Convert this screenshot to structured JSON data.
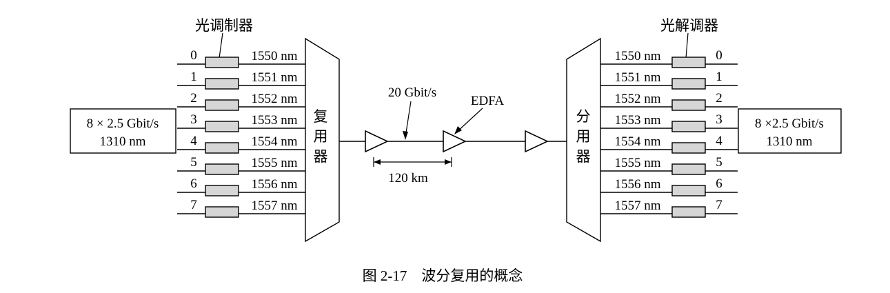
{
  "left": {
    "modulator_label": "光调制器",
    "mux_label": [
      "复",
      "用",
      "器"
    ],
    "source_box": [
      "8 × 2.5 Gbit/s",
      "1310 nm"
    ]
  },
  "right": {
    "demodulator_label": "光解调器",
    "demux_label": [
      "分",
      "用",
      "器"
    ],
    "sink_box": [
      "8 ×2.5 Gbit/s",
      "1310 nm"
    ]
  },
  "channels": [
    {
      "index": "0",
      "wavelength": "1550 nm"
    },
    {
      "index": "1",
      "wavelength": "1551 nm"
    },
    {
      "index": "2",
      "wavelength": "1552 nm"
    },
    {
      "index": "3",
      "wavelength": "1553 nm"
    },
    {
      "index": "4",
      "wavelength": "1554 nm"
    },
    {
      "index": "5",
      "wavelength": "1555 nm"
    },
    {
      "index": "6",
      "wavelength": "1556 nm"
    },
    {
      "index": "7",
      "wavelength": "1557 nm"
    }
  ],
  "link": {
    "rate_label": "20 Gbit/s",
    "amplifier_label": "EDFA",
    "span_label": "120 km"
  },
  "caption": "图 2-17　波分复用的概念"
}
